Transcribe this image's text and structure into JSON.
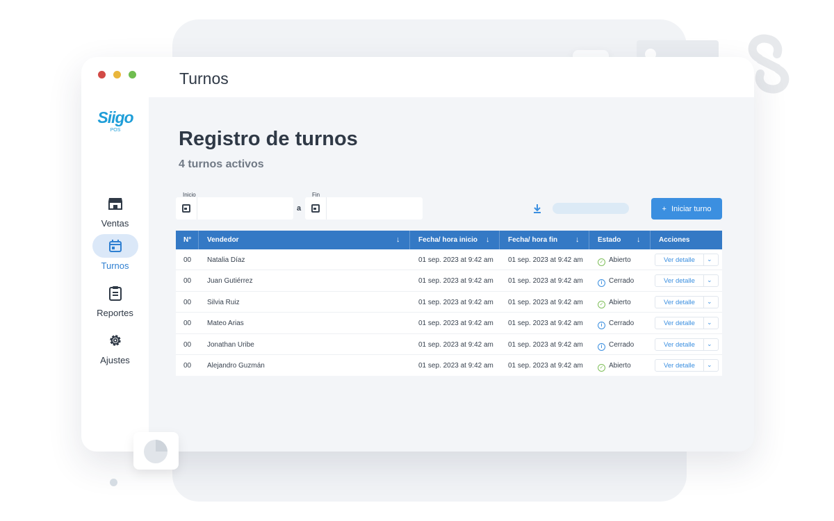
{
  "window": {
    "title": "Turnos",
    "dot_colors": [
      "#d24a46",
      "#e9b63c",
      "#6fbd4f"
    ]
  },
  "brand": {
    "logo_text": "Siigo",
    "logo_sub": "POS",
    "color": "#1f9ed8"
  },
  "sidebar": {
    "items": [
      {
        "label": "Ventas",
        "icon": "store-icon",
        "active": false
      },
      {
        "label": "Turnos",
        "icon": "calendar-icon",
        "active": true
      },
      {
        "label": "Reportes",
        "icon": "clipboard-icon",
        "active": false
      },
      {
        "label": "Ajustes",
        "icon": "gear-icon",
        "active": false
      }
    ]
  },
  "main": {
    "heading": "Registro de turnos",
    "subheading": "4 turnos activos",
    "filters": {
      "start_label": "Inicio",
      "end_label": "Fin",
      "separator": "a",
      "start_value": "",
      "end_value": ""
    },
    "start_button": {
      "icon": "plus-icon",
      "label": "Iniciar turno"
    },
    "accent_color": "#3b8fe0",
    "header_color": "#3479c5"
  },
  "table": {
    "columns": [
      "N°",
      "Vendedor",
      "Fecha/ hora inicio",
      "Fecha/ hora fin",
      "Estado",
      "Acciones"
    ],
    "action_label": "Ver detalle",
    "rows": [
      {
        "n": "00",
        "seller": "Natalia Díaz",
        "start": "01 sep. 2023 at 9:42 am",
        "end": "01 sep. 2023 at 9:42 am",
        "status": "Abierto",
        "status_icon": "check-circle-icon"
      },
      {
        "n": "00",
        "seller": "Juan Gutiérrez",
        "start": "01 sep. 2023 at 9:42 am",
        "end": "01 sep. 2023 at 9:42 am",
        "status": "Cerrado",
        "status_icon": "info-circle-icon"
      },
      {
        "n": "00",
        "seller": "Silvia Ruiz",
        "start": "01 sep. 2023 at 9:42 am",
        "end": "01 sep. 2023 at 9:42 am",
        "status": "Abierto",
        "status_icon": "check-circle-icon"
      },
      {
        "n": "00",
        "seller": "Mateo Arias",
        "start": "01 sep. 2023 at 9:42 am",
        "end": "01 sep. 2023 at 9:42 am",
        "status": "Cerrado",
        "status_icon": "info-circle-icon"
      },
      {
        "n": "00",
        "seller": "Jonathan Uribe",
        "start": "01 sep. 2023 at 9:42 am",
        "end": "01 sep. 2023 at 9:42 am",
        "status": "Cerrado",
        "status_icon": "info-circle-icon"
      },
      {
        "n": "00",
        "seller": "Alejandro Guzmán",
        "start": "01 sep. 2023 at 9:42 am",
        "end": "01 sep. 2023 at 9:42 am",
        "status": "Abierto",
        "status_icon": "check-circle-icon"
      }
    ]
  },
  "pagination": {
    "buttons": [
      {
        "name": "first-page-icon",
        "glyph": "|‹"
      },
      {
        "name": "prev-page-icon",
        "glyph": "‹"
      },
      {
        "name": "next-page-icon",
        "glyph": "›"
      },
      {
        "name": "last-page-icon",
        "glyph": "›|"
      }
    ]
  }
}
